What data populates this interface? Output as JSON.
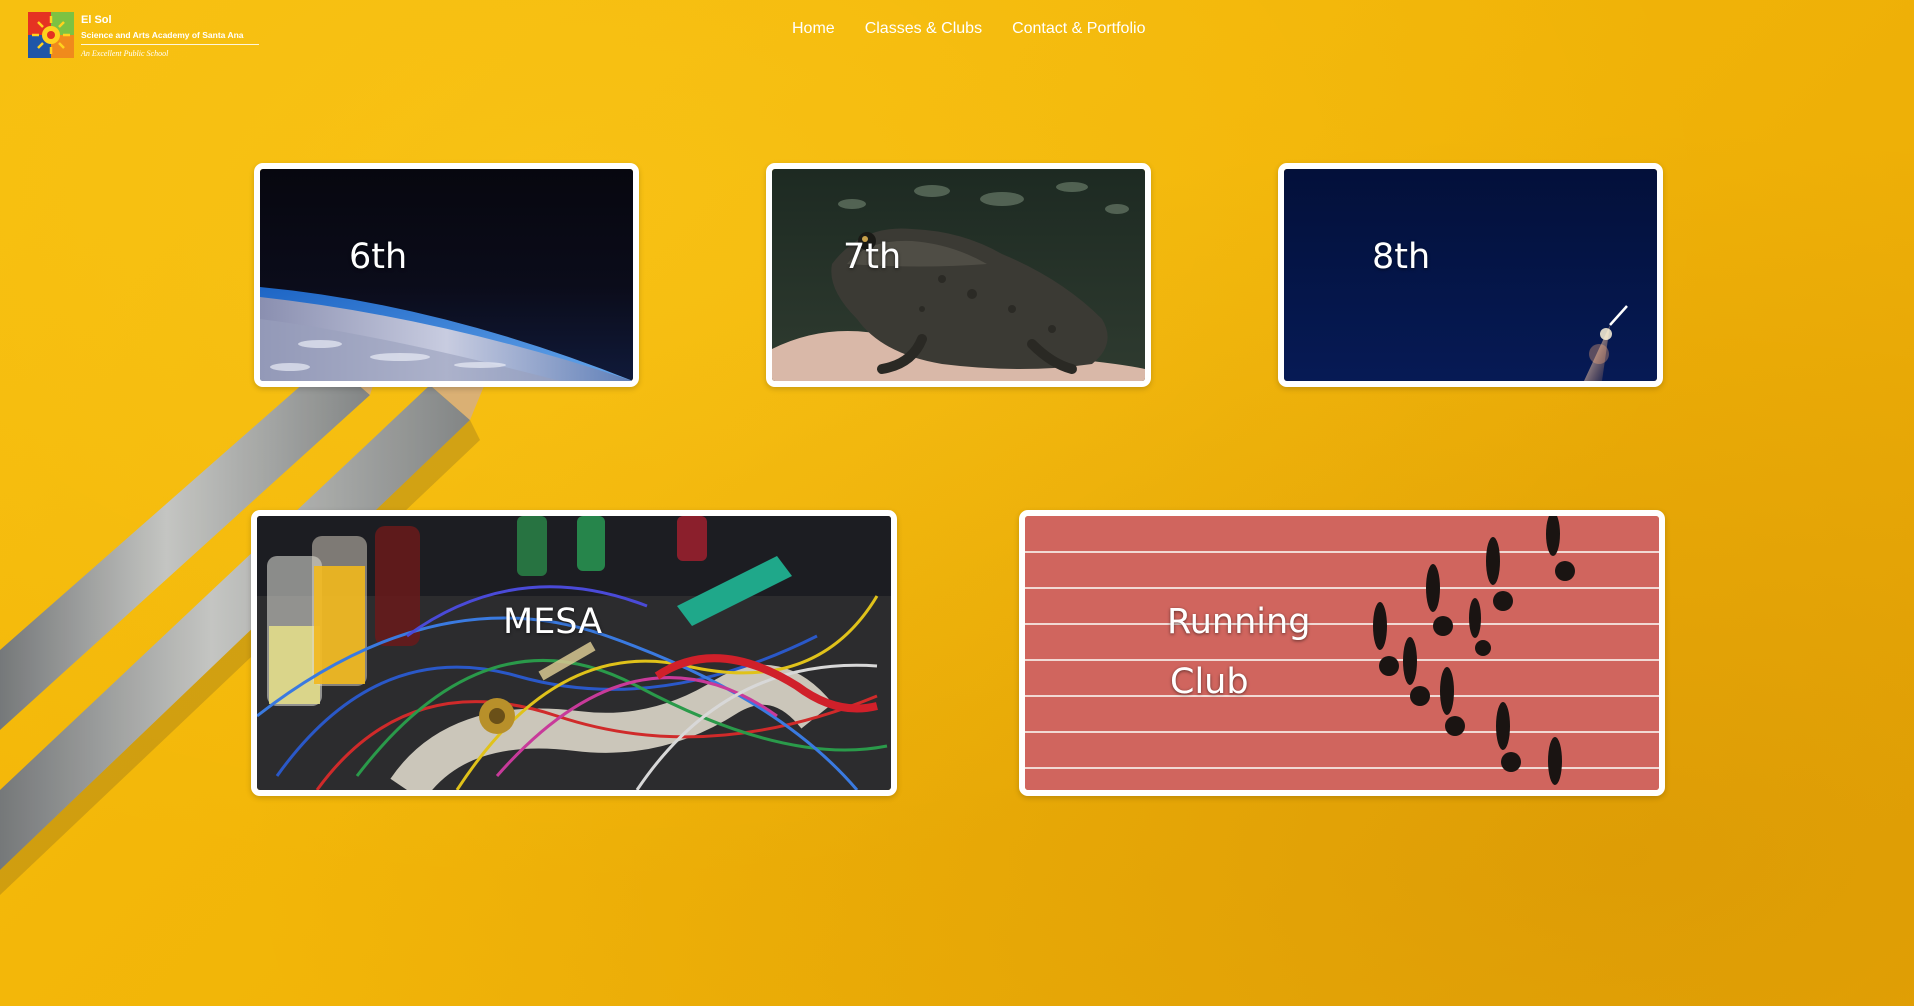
{
  "header": {
    "logo": {
      "title": "El Sol",
      "subtitle": "Science and Arts Academy of Santa Ana",
      "tagline": "An Excellent Public School"
    },
    "nav": [
      {
        "label": "Home"
      },
      {
        "label": "Classes & Clubs"
      },
      {
        "label": "Contact & Portfolio"
      }
    ]
  },
  "cards": {
    "sixth": {
      "label": "6th",
      "image": "earth-from-space-image"
    },
    "seventh": {
      "label": "7th",
      "image": "frog-on-hand-image"
    },
    "eighth": {
      "label": "8th",
      "image": "rocket-launch-image"
    },
    "mesa": {
      "label": "MESA",
      "image": "electronics-wires-image"
    },
    "running": {
      "label_line1": "Running",
      "label_line2": "Club",
      "image": "running-track-image"
    }
  },
  "colors": {
    "background": "#f2b508",
    "card_border": "#ffffff",
    "nav_text": "#ffffff"
  }
}
